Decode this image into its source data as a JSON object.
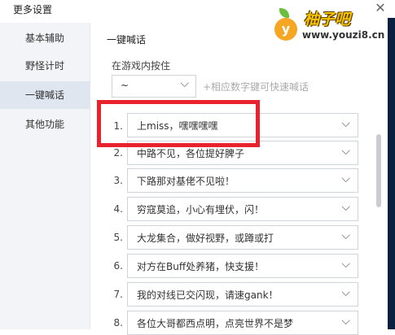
{
  "window": {
    "title": "更多设置",
    "close_glyph": "✕"
  },
  "sidebar": {
    "items": [
      {
        "label": "基本辅助"
      },
      {
        "label": "野怪计时"
      },
      {
        "label": "一键喊话"
      },
      {
        "label": "其他功能"
      }
    ],
    "active_index": 2
  },
  "main": {
    "section_title": "一键喊话",
    "hint_label": "在游戏内按住",
    "key_select_value": "~",
    "help_text": "+相应数字键可快速喊话",
    "rows": [
      {
        "num": "1.",
        "text": "上miss，嘿嘿嘿嘿"
      },
      {
        "num": "2.",
        "text": "中路不见，各位提好脾子"
      },
      {
        "num": "3.",
        "text": "下路那对基佬不见啦！"
      },
      {
        "num": "4.",
        "text": "穷寇莫追，小心有埋伏，闪！"
      },
      {
        "num": "5.",
        "text": "大龙集合，做好视野，或蹲或打"
      },
      {
        "num": "6.",
        "text": "对方在Buff处养猪，快支援！"
      },
      {
        "num": "7.",
        "text": "我的对线已交闪现，请速gank！"
      },
      {
        "num": "8.",
        "text": "各位大哥都西点明，点亮世界不是梦"
      }
    ]
  },
  "watermark": {
    "badge": "y",
    "name": "柚子吧",
    "url": "www.youzi8.cn"
  },
  "colors": {
    "highlight": "#e8232d",
    "sidebar_bg": "#f2f4f7",
    "active_bg": "#dfe6f0"
  }
}
